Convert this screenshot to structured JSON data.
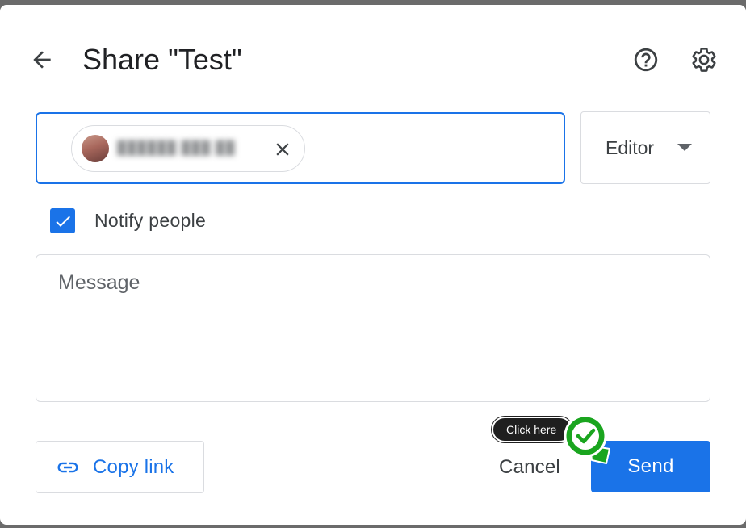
{
  "dialog": {
    "title": "Share \"Test\""
  },
  "icons": {
    "back": "arrow-back-icon",
    "help": "help-circle-icon",
    "settings": "gear-icon",
    "remove": "close-icon",
    "dropdown": "caret-down-icon",
    "checkbox": "checkmark-icon",
    "link": "link-icon",
    "marker": "green-check-marker-icon"
  },
  "recipients": {
    "chips": [
      {
        "name": "██████  ███ ██"
      }
    ]
  },
  "role": {
    "selected": "Editor"
  },
  "notify": {
    "label": "Notify people",
    "checked": true
  },
  "message": {
    "placeholder": "Message",
    "value": ""
  },
  "actions": {
    "copy_link": "Copy link",
    "cancel": "Cancel",
    "send": "Send"
  },
  "annotation": {
    "tooltip": "Click here"
  },
  "colors": {
    "accent": "#1a73e8",
    "marker": "#1aa51f",
    "tooltip_bg": "#1f1f1f"
  }
}
